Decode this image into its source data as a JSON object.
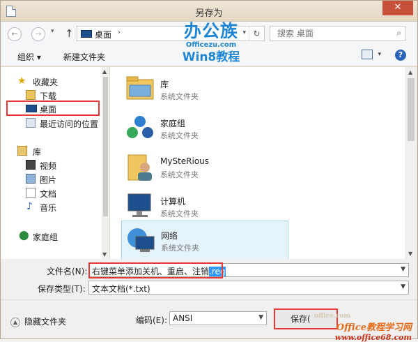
{
  "window": {
    "title": "另存为",
    "close": "✕"
  },
  "nav": {
    "back": "←",
    "forward": "→",
    "history": "▾",
    "up": "↑",
    "address": {
      "path": "桌面",
      "separator": "›",
      "dropdown": "▾",
      "refresh": "↻"
    },
    "search": {
      "placeholder": "搜索 桌面",
      "icon": "⌕"
    }
  },
  "toolbar": {
    "organize": "组织 ▾",
    "new_folder": "新建文件夹",
    "view_dd": "▾",
    "help": "?"
  },
  "logo": {
    "line1": "办公族",
    "line2": "Officezu.com",
    "line3": "Win8教程"
  },
  "sidebar": {
    "items": [
      {
        "label": "收藏夹",
        "icon": "star-icon"
      },
      {
        "label": "下载",
        "icon": "download-folder-icon"
      },
      {
        "label": "桌面",
        "icon": "desktop-icon",
        "highlighted": true
      },
      {
        "label": "最近访问的位置",
        "icon": "recent-places-icon"
      },
      {
        "label": "库",
        "icon": "library-icon"
      },
      {
        "label": "视频",
        "icon": "video-icon"
      },
      {
        "label": "图片",
        "icon": "pictures-icon"
      },
      {
        "label": "文档",
        "icon": "documents-icon"
      },
      {
        "label": "音乐",
        "icon": "music-icon"
      },
      {
        "label": "家庭组",
        "icon": "homegroup-icon"
      }
    ]
  },
  "files": [
    {
      "name": "库",
      "type": "系统文件夹",
      "icon": "library-folder-icon"
    },
    {
      "name": "家庭组",
      "type": "系统文件夹",
      "icon": "homegroup-icon"
    },
    {
      "name": "MySteRious",
      "type": "系统文件夹",
      "icon": "user-folder-icon"
    },
    {
      "name": "计算机",
      "type": "系统文件夹",
      "icon": "computer-icon"
    },
    {
      "name": "网络",
      "type": "系统文件夹",
      "icon": "network-icon",
      "selected": true
    }
  ],
  "form": {
    "filename_label": "文件名(N):",
    "filename_value": "右键菜单添加关机、重启、注销",
    "filename_ext": ".reg",
    "filetype_label": "保存类型(T):",
    "filetype_value": "文本文档(*.txt)"
  },
  "footer": {
    "hide_folders": "隐藏文件夹",
    "encoding_label": "编码(E):",
    "encoding_value": "ANSI",
    "save": "保存(",
    "watermark_top": "office.com",
    "watermark_main": "Office教程学习网",
    "watermark_url": "www.office68.com"
  }
}
